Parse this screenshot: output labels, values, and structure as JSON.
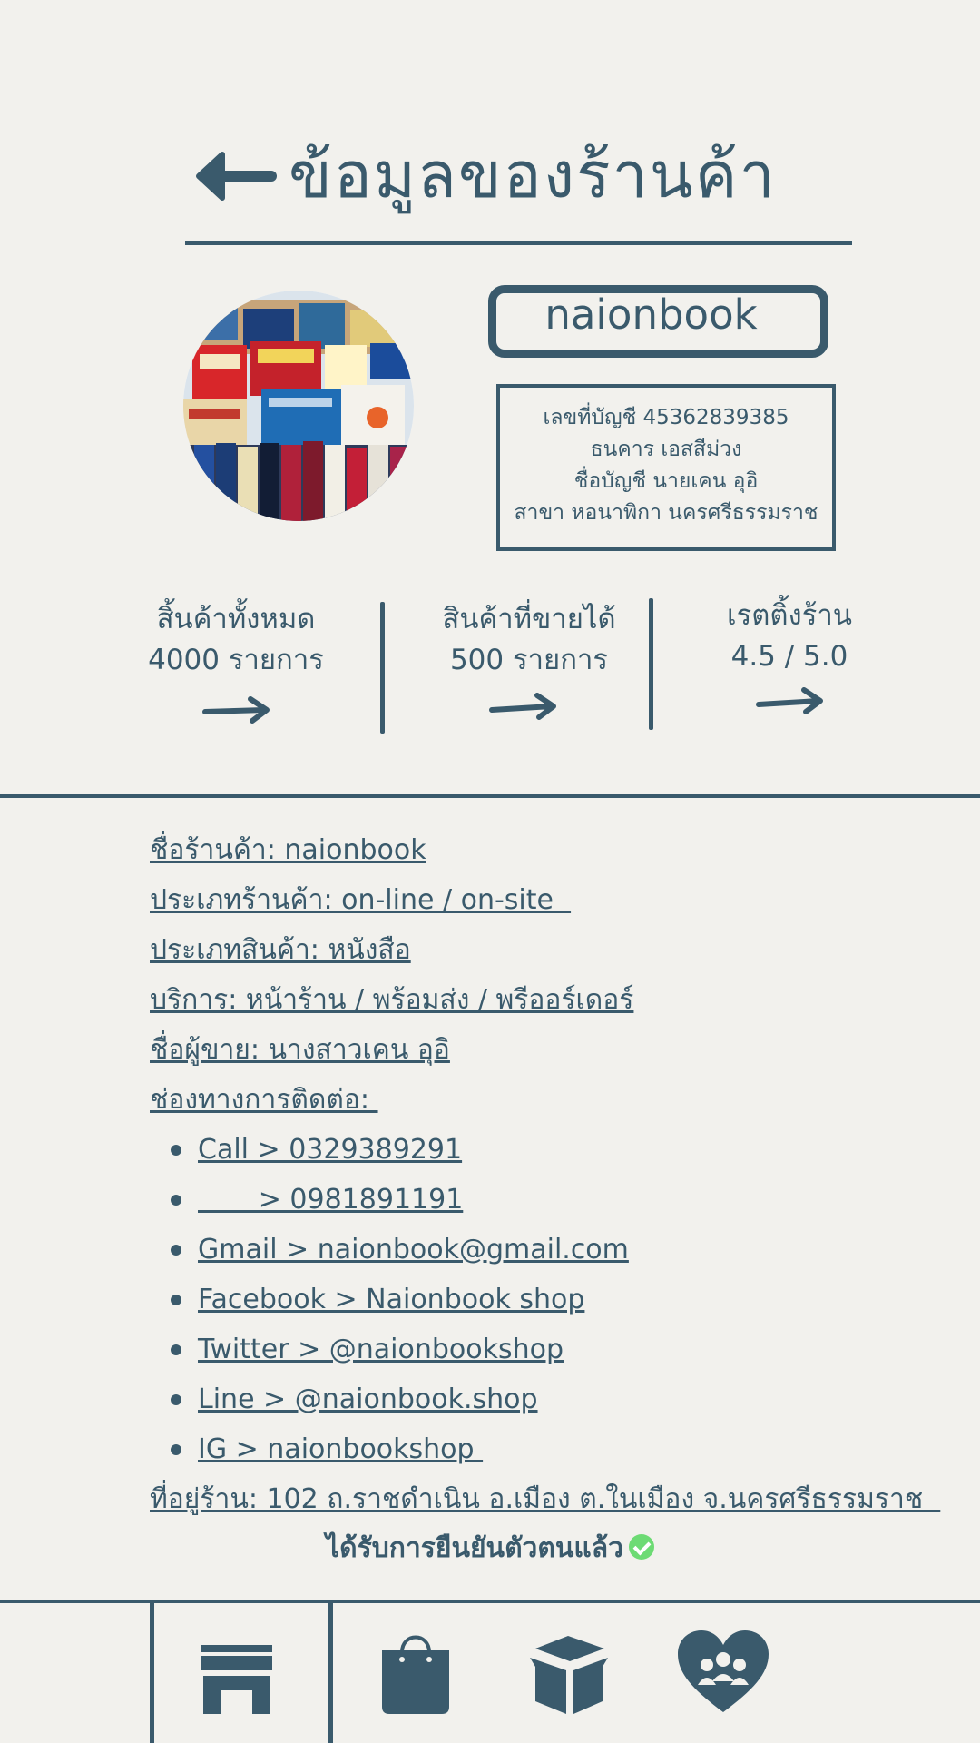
{
  "header": {
    "title": "ข้อมูลของร้านค้า",
    "back_icon": "arrow-left-icon"
  },
  "store": {
    "avatar_icon": "book-stack-photo",
    "name": "naionbook"
  },
  "bank": {
    "account_number": "เลขที่บัญชี 45362839385",
    "bank_name": "ธนคาร เอสสีม่วง",
    "account_name": "ชื่อบัญชี นายเคน อุอิ",
    "branch": "สาขา หอนาพิกา นครศรีธรรมราช"
  },
  "stats": [
    {
      "label": "สิ้นค้าทั้งหมด",
      "value": "4000 รายการ"
    },
    {
      "label": "สินค้าที่ขายได้",
      "value": "500 รายการ"
    },
    {
      "label": "เรตติ้งร้าน",
      "value": "4.5 / 5.0"
    }
  ],
  "info": {
    "store_name": "ชื่อร้านค้า: naionbook",
    "store_type": "ประเภทร้านค้า: on-line / on-site  ",
    "product_type": "ประเภทสินค้า: หนังสือ",
    "services": "บริการ: หน้าร้าน / พร้อมส่ง / พรีออร์เดอร์",
    "seller": "ชื่อผู้ขาย: นางสาวเคน อุอิ",
    "contact_heading": "ช่องทางการติดต่อ: "
  },
  "contacts": [
    "Call > 0329389291",
    "       > 0981891191",
    "Gmail > naionbook@gmail.com",
    "Facebook > Naionbook shop",
    "Twitter > @naionbookshop",
    "Line > @naionbook.shop",
    "IG > naionbookshop "
  ],
  "address": "ที่อยู่ร้าน: 102 ถ.ราชดำเนิน อ.เมือง ต.ในเมือง จ.นครศรีธรรมราช  ",
  "verified": "ได้รับการยืนยันตัวตนแล้ว",
  "colors": {
    "background": "#f2f1ed",
    "primary": "#3a5a6c",
    "verified": "#6ddb74"
  },
  "nav": [
    "store-icon",
    "shopping-bag-icon",
    "box-icon",
    "community-heart-icon"
  ]
}
